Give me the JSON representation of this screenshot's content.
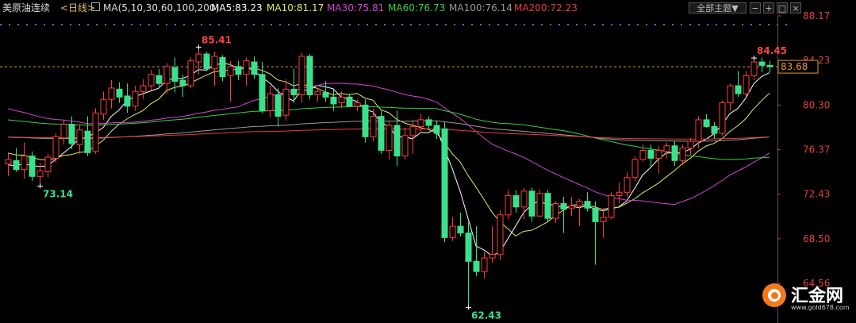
{
  "header": {
    "symbol": "美原油连续",
    "period": "<日线>",
    "ma_params": "MA(5,10,30,60,100,200)",
    "ma5": "MA5:83.23",
    "ma10": "MA10:81.17",
    "ma30": "MA30:75.81",
    "ma60": "MA60:76.73",
    "ma100": "MA100:76.14",
    "ma200": "MA200:72.23",
    "theme_button": "全部主题▼"
  },
  "colors": {
    "background": "#000000",
    "up": "#ff3c3c",
    "down": "#3ce08c",
    "ma5": "#ffffff",
    "ma10": "#e8e85a",
    "ma30": "#d642d6",
    "ma60": "#3cd03c",
    "ma100": "#9a9a9a",
    "ma200": "#e83c3c"
  },
  "logo": {
    "name": "汇金网",
    "url": "www.gold678.com"
  },
  "chart_data": {
    "type": "candlestick",
    "y_ticks": [
      "88.17",
      "84.23",
      "80.30",
      "76.37",
      "72.43",
      "68.50",
      "64.56"
    ],
    "ylim": [
      62.6,
      88.17
    ],
    "last_price": "83.68",
    "annotations": [
      {
        "text": "85.41",
        "index": 24,
        "kind": "high"
      },
      {
        "text": "73.14",
        "index": 4,
        "kind": "low"
      },
      {
        "text": "62.43",
        "index": 58,
        "kind": "low"
      },
      {
        "text": "84.45",
        "index": 94,
        "kind": "high"
      }
    ],
    "candles": [
      [
        75.1,
        76.0,
        74.0,
        75.5
      ],
      [
        75.4,
        76.5,
        74.4,
        74.6
      ],
      [
        74.6,
        77.0,
        73.8,
        75.8
      ],
      [
        75.8,
        76.2,
        73.6,
        74.0
      ],
      [
        74.0,
        75.2,
        73.1,
        74.5
      ],
      [
        74.4,
        76.0,
        73.9,
        75.7
      ],
      [
        75.6,
        77.8,
        75.2,
        77.5
      ],
      [
        77.4,
        79.0,
        76.8,
        78.6
      ],
      [
        78.6,
        79.3,
        76.4,
        76.9
      ],
      [
        76.8,
        78.5,
        76.0,
        78.1
      ],
      [
        78.0,
        79.3,
        75.8,
        76.1
      ],
      [
        76.2,
        80.0,
        76.0,
        79.6
      ],
      [
        79.5,
        81.5,
        79.0,
        80.8
      ],
      [
        80.8,
        82.5,
        80.0,
        81.8
      ],
      [
        81.7,
        82.3,
        80.5,
        81.0
      ],
      [
        81.1,
        82.2,
        79.6,
        80.2
      ],
      [
        80.2,
        82.0,
        79.8,
        81.5
      ],
      [
        81.5,
        82.6,
        80.8,
        82.0
      ],
      [
        82.0,
        83.4,
        81.6,
        83.0
      ],
      [
        82.9,
        83.5,
        81.9,
        82.2
      ],
      [
        82.2,
        84.0,
        81.3,
        83.7
      ],
      [
        83.6,
        84.5,
        81.4,
        82.4
      ],
      [
        82.5,
        83.0,
        81.0,
        82.0
      ],
      [
        82.0,
        84.5,
        81.8,
        84.2
      ],
      [
        84.1,
        85.41,
        83.0,
        84.8
      ],
      [
        84.8,
        85.0,
        83.3,
        83.5
      ],
      [
        83.5,
        85.0,
        82.0,
        84.6
      ],
      [
        84.5,
        84.7,
        82.4,
        82.8
      ],
      [
        82.9,
        84.2,
        80.6,
        83.7
      ],
      [
        83.7,
        84.2,
        82.5,
        83.0
      ],
      [
        83.0,
        84.5,
        82.0,
        84.2
      ],
      [
        84.1,
        84.6,
        82.6,
        83.0
      ],
      [
        83.0,
        84.1,
        79.6,
        79.8
      ],
      [
        79.8,
        82.0,
        79.2,
        81.3
      ],
      [
        81.2,
        81.8,
        78.4,
        79.3
      ],
      [
        79.4,
        82.6,
        78.9,
        81.7
      ],
      [
        81.7,
        83.5,
        80.5,
        81.2
      ],
      [
        81.2,
        84.9,
        80.5,
        84.6
      ],
      [
        84.6,
        84.8,
        80.8,
        81.2
      ],
      [
        81.2,
        81.8,
        80.6,
        81.5
      ],
      [
        81.4,
        82.4,
        80.6,
        81.0
      ],
      [
        81.0,
        81.7,
        79.8,
        80.4
      ],
      [
        80.5,
        81.5,
        80.0,
        81.0
      ],
      [
        81.0,
        81.3,
        80.1,
        80.2
      ],
      [
        80.2,
        80.8,
        79.8,
        80.5
      ],
      [
        80.3,
        80.8,
        77.0,
        77.5
      ],
      [
        77.5,
        80.0,
        77.1,
        79.3
      ],
      [
        79.3,
        79.8,
        76.0,
        76.3
      ],
      [
        76.3,
        78.8,
        75.5,
        78.5
      ],
      [
        78.5,
        79.8,
        74.9,
        75.8
      ],
      [
        75.8,
        78.3,
        75.5,
        77.6
      ],
      [
        77.6,
        79.0,
        76.0,
        78.4
      ],
      [
        78.4,
        79.5,
        77.8,
        79.0
      ],
      [
        79.0,
        79.3,
        78.2,
        78.5
      ],
      [
        78.5,
        78.9,
        77.3,
        77.8
      ],
      [
        78.2,
        78.8,
        68.2,
        68.6
      ],
      [
        68.6,
        70.4,
        68.3,
        69.6
      ],
      [
        69.6,
        70.8,
        68.7,
        69.0
      ],
      [
        69.0,
        70.0,
        62.43,
        66.5
      ],
      [
        66.5,
        69.6,
        65.2,
        65.6
      ],
      [
        65.6,
        67.3,
        65.0,
        66.8
      ],
      [
        66.8,
        69.6,
        66.4,
        67.1
      ],
      [
        67.1,
        71.0,
        66.6,
        70.6
      ],
      [
        70.6,
        72.8,
        70.2,
        72.3
      ],
      [
        72.3,
        72.8,
        70.8,
        71.3
      ],
      [
        71.3,
        73.0,
        70.2,
        72.7
      ],
      [
        72.7,
        73.0,
        70.0,
        70.5
      ],
      [
        70.5,
        72.8,
        70.4,
        72.5
      ],
      [
        72.5,
        72.8,
        70.0,
        70.3
      ],
      [
        70.3,
        71.8,
        69.9,
        71.6
      ],
      [
        71.6,
        72.2,
        69.0,
        71.1
      ],
      [
        71.2,
        72.2,
        70.5,
        71.4
      ],
      [
        71.4,
        72.0,
        69.6,
        71.8
      ],
      [
        71.8,
        72.6,
        70.9,
        71.2
      ],
      [
        71.2,
        71.8,
        66.2,
        70.0
      ],
      [
        70.0,
        71.2,
        68.6,
        70.4
      ],
      [
        70.4,
        72.6,
        70.2,
        72.3
      ],
      [
        72.3,
        73.5,
        71.6,
        72.6
      ],
      [
        72.6,
        74.4,
        72.2,
        73.9
      ],
      [
        73.9,
        75.8,
        73.6,
        75.5
      ],
      [
        75.5,
        76.8,
        75.3,
        76.3
      ],
      [
        76.3,
        76.8,
        74.9,
        75.6
      ],
      [
        75.6,
        76.7,
        74.3,
        76.3
      ],
      [
        76.2,
        77.0,
        75.6,
        76.7
      ],
      [
        76.7,
        77.1,
        74.9,
        75.4
      ],
      [
        75.4,
        76.8,
        75.0,
        76.5
      ],
      [
        76.5,
        77.4,
        75.9,
        77.1
      ],
      [
        77.1,
        79.3,
        76.5,
        79.0
      ],
      [
        79.0,
        79.5,
        78.3,
        78.4
      ],
      [
        78.4,
        78.8,
        77.3,
        77.8
      ],
      [
        77.8,
        80.7,
        77.6,
        80.5
      ],
      [
        80.5,
        82.2,
        79.8,
        82.0
      ],
      [
        82.0,
        83.3,
        81.0,
        81.3
      ],
      [
        81.3,
        83.3,
        81.0,
        82.9
      ],
      [
        82.9,
        84.45,
        82.5,
        84.1
      ],
      [
        84.1,
        84.5,
        83.2,
        83.8
      ],
      [
        83.8,
        84.2,
        83.2,
        83.68
      ]
    ]
  }
}
